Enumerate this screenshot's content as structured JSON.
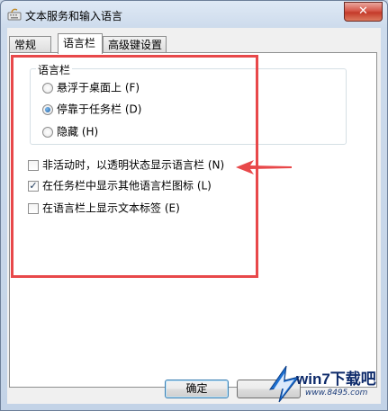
{
  "window": {
    "title": "文本服务和输入语言",
    "close_glyph": "✕"
  },
  "tabs": [
    {
      "label": "常规"
    },
    {
      "label": "语言栏"
    },
    {
      "label": "高级键设置"
    }
  ],
  "language_bar_group": {
    "title": "语言栏",
    "options": [
      {
        "label": "悬浮于桌面上 (F)",
        "checked": false
      },
      {
        "label": "停靠于任务栏 (D)",
        "checked": true
      },
      {
        "label": "隐藏 (H)",
        "checked": false
      }
    ]
  },
  "checkboxes": [
    {
      "label": "非活动时，以透明状态显示语言栏 (N)",
      "checked": false
    },
    {
      "label": "在任务栏中显示其他语言栏图标 (L)",
      "checked": true
    },
    {
      "label": "在语言栏上显示文本标签 (E)",
      "checked": false
    }
  ],
  "buttons": {
    "ok": "确定"
  },
  "annotation": {
    "box_color": "#e8484a",
    "arrow_color": "#e8484a"
  },
  "watermark": {
    "brand": "win7下载吧",
    "url": "www.8495.com"
  }
}
